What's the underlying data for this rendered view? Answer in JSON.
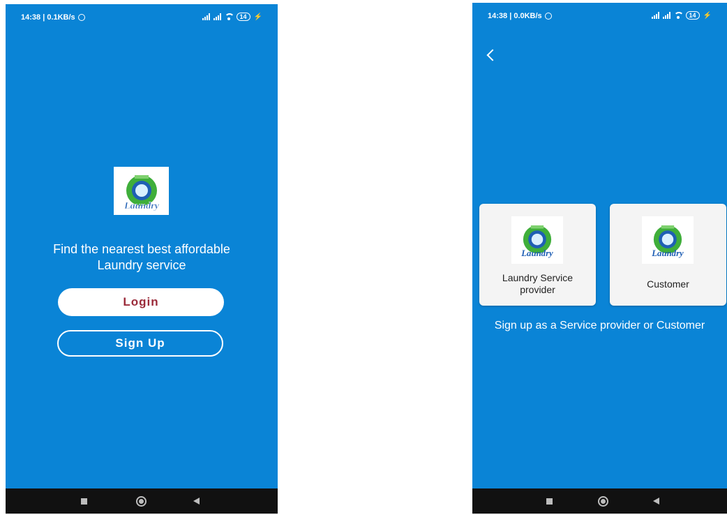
{
  "left_screen": {
    "status": {
      "time": "14:38 | 0.1KB/s",
      "battery": "14"
    },
    "logo_text": "Laundry",
    "tagline_line1": "Find the nearest best affordable",
    "tagline_line2": "Laundry service",
    "login_label": "Login",
    "signup_label": "Sign Up"
  },
  "right_screen": {
    "status": {
      "time": "14:38 | 0.0KB/s",
      "battery": "14"
    },
    "cards": [
      {
        "logo_text": "Laundry",
        "label_line1": "Laundry Service",
        "label_line2": "provider"
      },
      {
        "logo_text": "Laundry",
        "label": "Customer"
      }
    ],
    "hint": "Sign up as a Service provider or Customer"
  },
  "colors": {
    "background": "#0a84d6",
    "login_text": "#9b2b3a",
    "logo_green": "#3fae3a",
    "logo_blue": "#1f5fb4"
  },
  "icons": [
    "alarm-icon",
    "signal-icon",
    "wifi-icon",
    "battery-icon",
    "charging-icon",
    "back-arrow-icon",
    "recents-square-icon",
    "home-circle-icon",
    "back-triangle-icon",
    "laundry-logo-icon"
  ]
}
